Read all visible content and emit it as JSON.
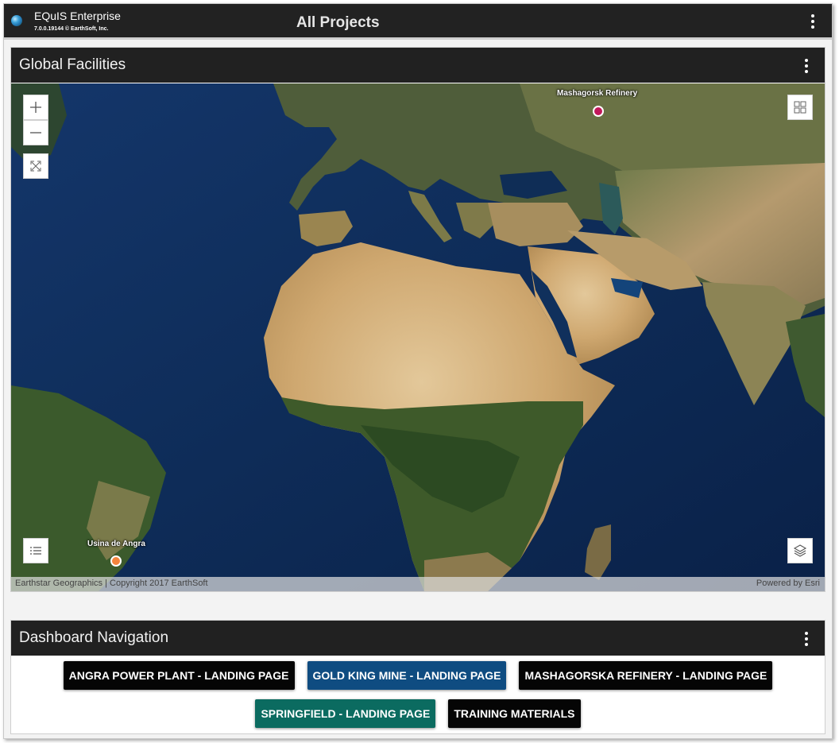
{
  "app": {
    "name": "EQuIS Enterprise",
    "version": "7.0.0.19144 © EarthSoft, Inc.",
    "page_title": "All Projects",
    "logo_icon": "globe-icon",
    "menu_icon": "more-vert-icon"
  },
  "map_panel": {
    "title": "Global Facilities",
    "menu_icon": "more-vert-icon",
    "controls": {
      "zoom_in_icon": "plus-icon",
      "zoom_out_icon": "minus-icon",
      "fullscreen_icon": "expand-icon",
      "overview_icon": "overview-map-icon",
      "legend_icon": "list-icon",
      "layers_icon": "layers-icon"
    },
    "facilities": [
      {
        "name": "Mashagorsk Refinery",
        "color": "#c2185b"
      },
      {
        "name": "Usina de Angra",
        "color": "#f4843d"
      }
    ],
    "attribution": {
      "left": "Earthstar Geographics | Copyright 2017 EarthSoft",
      "right": "Powered by Esri"
    }
  },
  "nav_panel": {
    "title": "Dashboard Navigation",
    "menu_icon": "more-vert-icon",
    "buttons": [
      {
        "label": "ANGRA POWER PLANT - LANDING PAGE",
        "color": "#050505"
      },
      {
        "label": "GOLD KING MINE - LANDING PAGE",
        "color": "#0f4c81"
      },
      {
        "label": "MASHAGORSKA REFINERY - LANDING PAGE",
        "color": "#050505"
      },
      {
        "label": "SPRINGFIELD - LANDING PAGE",
        "color": "#0b6b60"
      },
      {
        "label": "TRAINING MATERIALS",
        "color": "#050505"
      }
    ]
  }
}
